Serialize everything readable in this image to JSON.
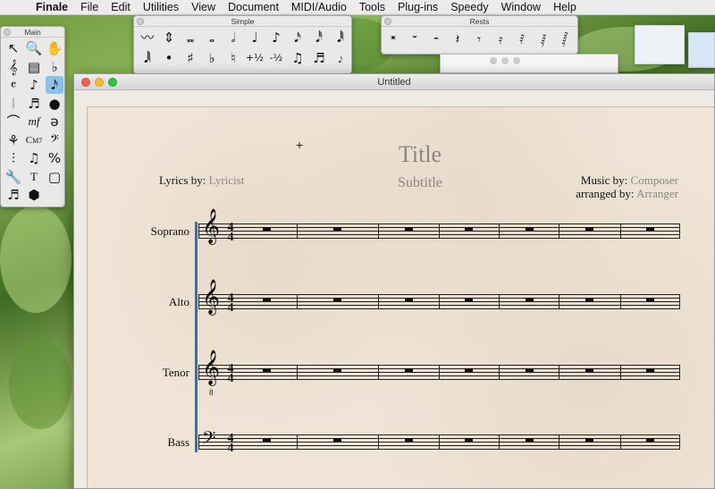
{
  "menubar": {
    "apple": "",
    "items": [
      "Finale",
      "File",
      "Edit",
      "Utilities",
      "View",
      "Document",
      "MIDI/Audio",
      "Tools",
      "Plug-ins",
      "Speedy",
      "Window",
      "Help"
    ]
  },
  "palettes": {
    "main": {
      "title": "Main",
      "tools": [
        {
          "glyph": "↖",
          "name": "selection-tool-icon"
        },
        {
          "glyph": "🔍",
          "name": "zoom-tool-icon"
        },
        {
          "glyph": "✋",
          "name": "hand-grabber-icon"
        },
        {
          "glyph": "𝄞",
          "name": "staff-tool-icon"
        },
        {
          "glyph": "▤",
          "name": "key-signature-tool-icon"
        },
        {
          "glyph": "♭",
          "name": "key-tool-icon"
        },
        {
          "glyph": "𝄴",
          "name": "time-signature-tool-icon"
        },
        {
          "glyph": "♪",
          "name": "simple-entry-tool-icon"
        },
        {
          "glyph": "𝅘𝅥𝅯",
          "name": "speedy-entry-tool-icon",
          "selected": true
        },
        {
          "glyph": "𝄀",
          "name": "measure-tool-icon"
        },
        {
          "glyph": "♬",
          "name": "tuplet-tool-icon"
        },
        {
          "glyph": "●",
          "name": "mirror-tool-icon"
        },
        {
          "glyph": "⌒",
          "name": "smart-shape-tool-icon"
        },
        {
          "glyph": "mf",
          "name": "expression-tool-icon"
        },
        {
          "glyph": "ə",
          "name": "articulation-tool-icon"
        },
        {
          "glyph": "⚘",
          "name": "lyrics-tool-icon"
        },
        {
          "glyph": "C",
          "name": "chord-tool-icon"
        },
        {
          "glyph": "𝄢",
          "name": "clef-tool-icon"
        },
        {
          "glyph": "⫶",
          "name": "repeat-tool-icon"
        },
        {
          "glyph": "♫",
          "name": "graphics-tool-icon"
        },
        {
          "glyph": "%",
          "name": "special-tools-icon"
        },
        {
          "glyph": "🔧",
          "name": "wrench-tool-icon"
        },
        {
          "glyph": "T",
          "name": "text-tool-icon"
        },
        {
          "glyph": "▢",
          "name": "page-layout-tool-icon"
        },
        {
          "glyph": "♬",
          "name": "note-mover-tool-icon"
        },
        {
          "glyph": "⬢",
          "name": "resize-tool-icon"
        }
      ],
      "chord_label": "C",
      "chord_sup": "M7"
    },
    "simple": {
      "title": "Simple",
      "row1": [
        {
          "glyph": "〰",
          "name": "eraser-icon"
        },
        {
          "glyph": "⇕",
          "name": "pitch-adjust-icon"
        },
        {
          "glyph": "𝅜",
          "name": "double-whole-note-icon"
        },
        {
          "glyph": "𝅝",
          "name": "whole-note-icon"
        },
        {
          "glyph": "𝅗𝅥",
          "name": "half-note-icon"
        },
        {
          "glyph": "♩",
          "name": "quarter-note-icon"
        },
        {
          "glyph": "♪",
          "name": "eighth-note-icon"
        },
        {
          "glyph": "𝅘𝅥𝅯",
          "name": "sixteenth-note-icon"
        },
        {
          "glyph": "𝅘𝅥𝅰",
          "name": "thirty-second-note-icon"
        },
        {
          "glyph": "𝅘𝅥𝅱",
          "name": "sixty-fourth-note-icon"
        }
      ],
      "row2": [
        {
          "glyph": "𝅘𝅥𝅲",
          "name": "128th-note-icon"
        },
        {
          "glyph": "•",
          "name": "dot-icon"
        },
        {
          "glyph": "♯",
          "name": "sharp-icon"
        },
        {
          "glyph": "♭",
          "name": "flat-icon"
        },
        {
          "glyph": "♮",
          "name": "natural-icon"
        },
        {
          "glyph": "+½",
          "name": "half-step-up-icon"
        },
        {
          "glyph": "-½",
          "name": "half-step-down-icon"
        },
        {
          "glyph": "♫",
          "name": "tie-icon"
        },
        {
          "glyph": "♬",
          "name": "tuplet-icon"
        },
        {
          "glyph": "𝆕",
          "name": "grace-note-icon"
        }
      ]
    },
    "rests": {
      "title": "Rests",
      "tools": [
        {
          "glyph": "𝄺",
          "name": "double-whole-rest-icon"
        },
        {
          "glyph": "𝄻",
          "name": "whole-rest-icon"
        },
        {
          "glyph": "𝄼",
          "name": "half-rest-icon"
        },
        {
          "glyph": "𝄽",
          "name": "quarter-rest-icon"
        },
        {
          "glyph": "𝄾",
          "name": "eighth-rest-icon"
        },
        {
          "glyph": "𝄿",
          "name": "sixteenth-rest-icon"
        },
        {
          "glyph": "𝅀",
          "name": "thirty-second-rest-icon"
        },
        {
          "glyph": "𝅁",
          "name": "sixty-fourth-rest-icon"
        },
        {
          "glyph": "𝅂",
          "name": "128th-rest-icon"
        }
      ]
    }
  },
  "document": {
    "window_title": "Untitled",
    "title": "Title",
    "subtitle": "Subtitle",
    "lyrics_label": "Lyrics by:",
    "lyricist": "Lyricist",
    "music_label": "Music by:",
    "composer": "Composer",
    "arranged_label": "arranged by:",
    "arranger": "Arranger",
    "parts": [
      {
        "name": "Soprano",
        "clef": "treble"
      },
      {
        "name": "Alto",
        "clef": "treble"
      },
      {
        "name": "Tenor",
        "clef": "treble8"
      },
      {
        "name": "Bass",
        "clef": "bass"
      }
    ],
    "time_signature": {
      "numerator": "4",
      "denominator": "4"
    },
    "measures_per_system": 7,
    "brace_color": "#3a6ea5"
  },
  "cursor": "+"
}
